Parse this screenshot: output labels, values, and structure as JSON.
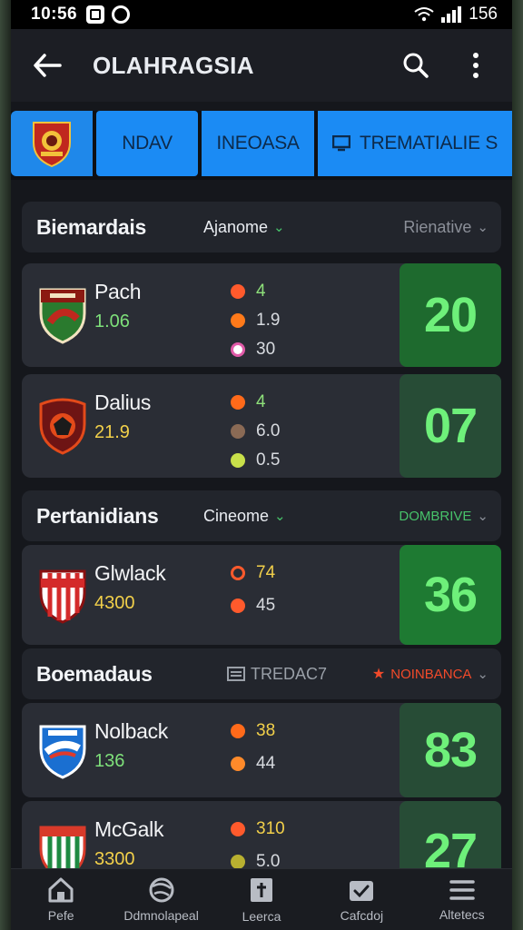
{
  "status_bar": {
    "time": "10:56",
    "battery": "156"
  },
  "app_bar": {
    "title": "OLAHRAGSIA"
  },
  "tabs": [
    {
      "label": "NDAV"
    },
    {
      "label": "INEOASA"
    },
    {
      "label": "TREMATIALIE S"
    }
  ],
  "sections": [
    {
      "name": "Biemardais",
      "filter": "Ajanome",
      "sort": "Rienative",
      "matches": [
        {
          "team": "Pach",
          "odds": "1.06",
          "score": "20",
          "stats": [
            {
              "value": "4",
              "color": "#ff5a2c"
            },
            {
              "value": "1.9",
              "color": "#ff7a1a"
            },
            {
              "value": "30",
              "color": "#e05aa8"
            }
          ],
          "crest_colors": [
            "#8b1a12",
            "#2a7a2e",
            "#f2e3c0"
          ],
          "score_bg": "#1e6a2e"
        },
        {
          "team": "Dalius",
          "odds": "21.9",
          "score": "07",
          "stats": [
            {
              "value": "4",
              "color": "#ff6a1a"
            },
            {
              "value": "6.0",
              "color": "#8a6a55"
            },
            {
              "value": "0.5",
              "color": "#c8e04a"
            }
          ],
          "crest_colors": [
            "#6e1414",
            "#e34a1a",
            "#1b1b1b"
          ],
          "score_bg": "#274c36"
        }
      ]
    },
    {
      "name": "Pertanidians",
      "filter": "Cineome",
      "sort": "DOMBRIVE",
      "matches": [
        {
          "team": "Glwlack",
          "odds": "4300",
          "score": "36",
          "stats": [
            {
              "value": "74",
              "color": "#ff5a2c"
            },
            {
              "value": "45",
              "color": "#ff5a2c"
            }
          ],
          "crest_colors": [
            "#ffffff",
            "#d42a2a",
            "#8a1010"
          ],
          "score_bg": "#1e7a32"
        }
      ]
    },
    {
      "name": "Boemadaus",
      "filter": "TREDAC7",
      "sort": "NOINBANCA",
      "matches": [
        {
          "team": "Nolback",
          "odds": "136",
          "score": "83",
          "stats": [
            {
              "value": "38",
              "color": "#ff6a1a"
            },
            {
              "value": "44",
              "color": "#ff8a2a"
            }
          ],
          "crest_colors": [
            "#1a6fd1",
            "#ffffff",
            "#e03a2a"
          ],
          "score_bg": "#274c36"
        },
        {
          "team": "McGalk",
          "odds": "3300",
          "score": "27",
          "stats": [
            {
              "value": "310",
              "color": "#ff5a2c"
            },
            {
              "value": "5.0",
              "color": "#b8b030"
            }
          ],
          "crest_colors": [
            "#d83a2a",
            "#1e8a42",
            "#ffffff"
          ],
          "score_bg": "#274c36"
        }
      ]
    }
  ],
  "bottom_nav": [
    {
      "label": "Pefe",
      "icon": "home-icon"
    },
    {
      "label": "Ddmnolapeal",
      "icon": "ball-icon"
    },
    {
      "label": "Leerca",
      "icon": "book-icon"
    },
    {
      "label": "Cafcdoj",
      "icon": "calendar-icon"
    },
    {
      "label": "Altetecs",
      "icon": "menu-icon"
    }
  ],
  "colors": {
    "accent": "#1b8bf4",
    "score_green": "#6ef07a",
    "odds_green": "#7ee07a"
  }
}
